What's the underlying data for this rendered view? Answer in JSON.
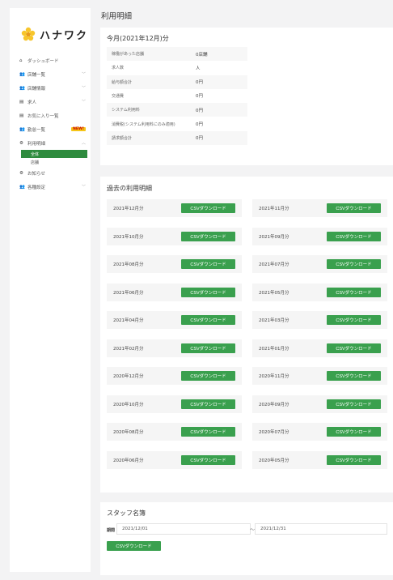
{
  "app": {
    "logo_text": "ハナワク"
  },
  "sidebar": {
    "items": [
      {
        "icon": "⌂",
        "icon_name": "home-icon",
        "label": "ダッシュボード",
        "chevron": false
      },
      {
        "icon": "👥",
        "icon_name": "users-icon",
        "label": "店舗一覧",
        "chevron": true
      },
      {
        "icon": "👥",
        "icon_name": "users-icon",
        "label": "店舗情報",
        "chevron": true
      },
      {
        "icon": "▤",
        "icon_name": "list-icon",
        "label": "求人",
        "chevron": true
      },
      {
        "icon": "▤",
        "icon_name": "list-icon",
        "label": "お気に入り一覧",
        "chevron": false
      },
      {
        "icon": "👥",
        "icon_name": "users-icon",
        "label": "勤怠一覧",
        "badge": "NEW!",
        "chevron": false
      },
      {
        "icon": "⚙",
        "icon_name": "gear-icon",
        "label": "利用明細",
        "chevron": true,
        "open": true
      },
      {
        "icon": "⚙",
        "icon_name": "gear-icon",
        "label": "お知らせ",
        "chevron": false
      },
      {
        "icon": "👥",
        "icon_name": "users-icon",
        "label": "各種設定",
        "chevron": true
      }
    ],
    "sub_items": [
      {
        "label": "全体",
        "active": true
      },
      {
        "label": "店舗",
        "active": false
      }
    ]
  },
  "page": {
    "title": "利用明細"
  },
  "current": {
    "title": "今月(2021年12月)分",
    "rows": [
      {
        "label": "稼働があった店舗",
        "value": "0店舗"
      },
      {
        "label": "求人数",
        "value": "人"
      },
      {
        "label": "給与額合計",
        "value": "0円"
      },
      {
        "label": "交通費",
        "value": "0円"
      },
      {
        "label": "システム利用料",
        "value": "0円"
      },
      {
        "label": "消費税(システム利用料にのみ適用)",
        "value": "0円"
      },
      {
        "label": "請求額合計",
        "value": "0円"
      }
    ]
  },
  "history": {
    "title": "過去の利用明細",
    "button_label": "CSVダウンロード",
    "periods": [
      "2021年12月分",
      "2021年11月分",
      "2021年10月分",
      "2021年09月分",
      "2021年08月分",
      "2021年07月分",
      "2021年06月分",
      "2021年05月分",
      "2021年04月分",
      "2021年03月分",
      "2021年02月分",
      "2021年01月分",
      "2020年12月分",
      "2020年11月分",
      "2020年10月分",
      "2020年09月分",
      "2020年08月分",
      "2020年07月分",
      "2020年06月分",
      "2020年05月分"
    ]
  },
  "staff": {
    "title": "スタッフ名簿",
    "period_label": "期間",
    "start_date": "2021/12/01",
    "separator": "〜",
    "end_date": "2021/12/31",
    "button_label": "CSVダウンロード"
  }
}
